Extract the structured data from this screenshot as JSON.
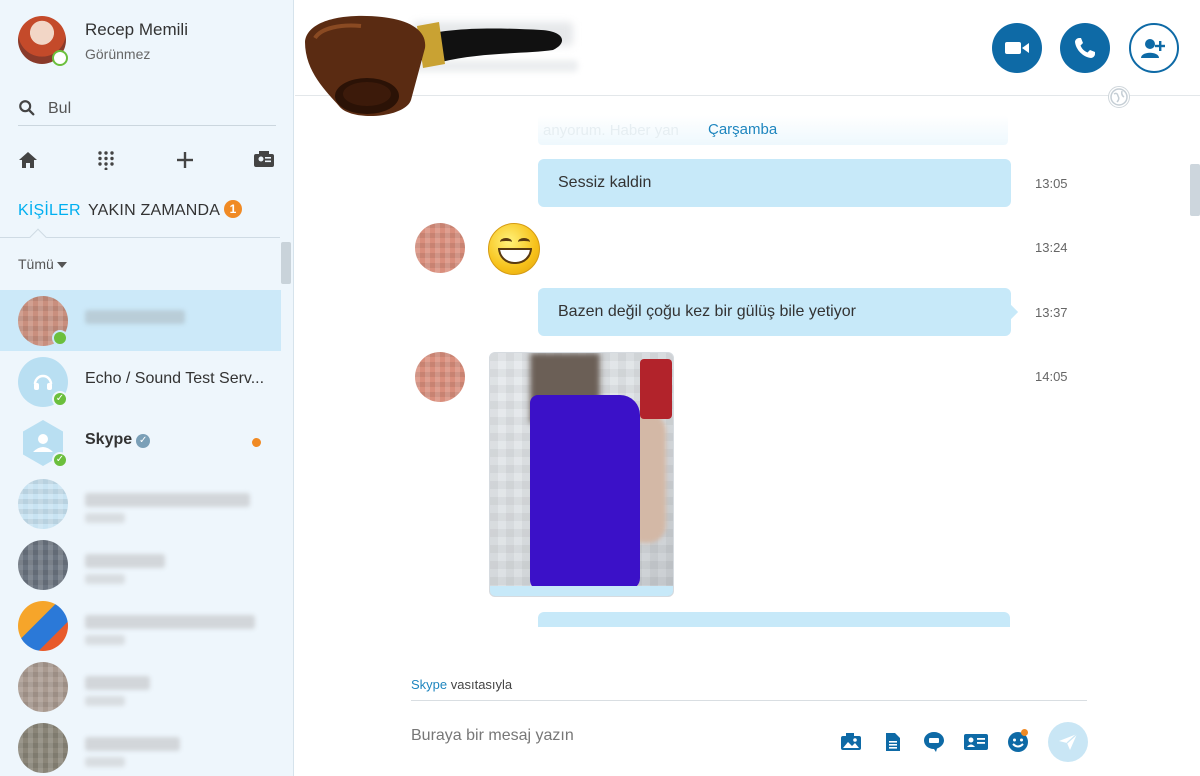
{
  "profile": {
    "name": "Recep Memili",
    "status": "Görünmez"
  },
  "search": {
    "label": "Bul"
  },
  "tabs": {
    "contacts": "KİŞİLER",
    "recent": "YAKIN ZAMANDA",
    "recent_badge": "1"
  },
  "filter": {
    "label": "Tümü"
  },
  "contacts": [
    {
      "name": "",
      "blurred": true,
      "selected": true
    },
    {
      "name": "Echo / Sound Test Serv...",
      "icon": "headset-icon",
      "presence": "online"
    },
    {
      "name": "Skype",
      "icon": "user-hexagon-icon",
      "verified": true,
      "unread": true,
      "presence": "online"
    },
    {
      "name": "",
      "blurred": true
    },
    {
      "name": "",
      "blurred": true
    },
    {
      "name": "",
      "blurred": true
    },
    {
      "name": "",
      "blurred": true
    },
    {
      "name": "",
      "blurred": true
    }
  ],
  "chat": {
    "faded_text": "anyorum. Haber yan",
    "day_label": "Çarşamba",
    "messages": [
      {
        "direction": "out",
        "text": "Sessiz kaldin",
        "time": "13:05"
      },
      {
        "direction": "in",
        "type": "emoji",
        "emoji": "grinning-face",
        "time": "13:24"
      },
      {
        "direction": "out",
        "text": "Bazen değil çoğu kez bir gülüş bile yetiyor",
        "time": "13:37"
      },
      {
        "direction": "in",
        "type": "photo",
        "time": "14:05"
      }
    ]
  },
  "compose": {
    "via_link": "Skype",
    "via_suffix": " vasıtasıyla",
    "placeholder": "Buraya bir mesaj yazın"
  },
  "colors": {
    "accent": "#00aff0",
    "header_button": "#0e6aa6",
    "bubble": "#c7e9f9",
    "badge": "#f08a24",
    "online": "#6bbf3d"
  }
}
